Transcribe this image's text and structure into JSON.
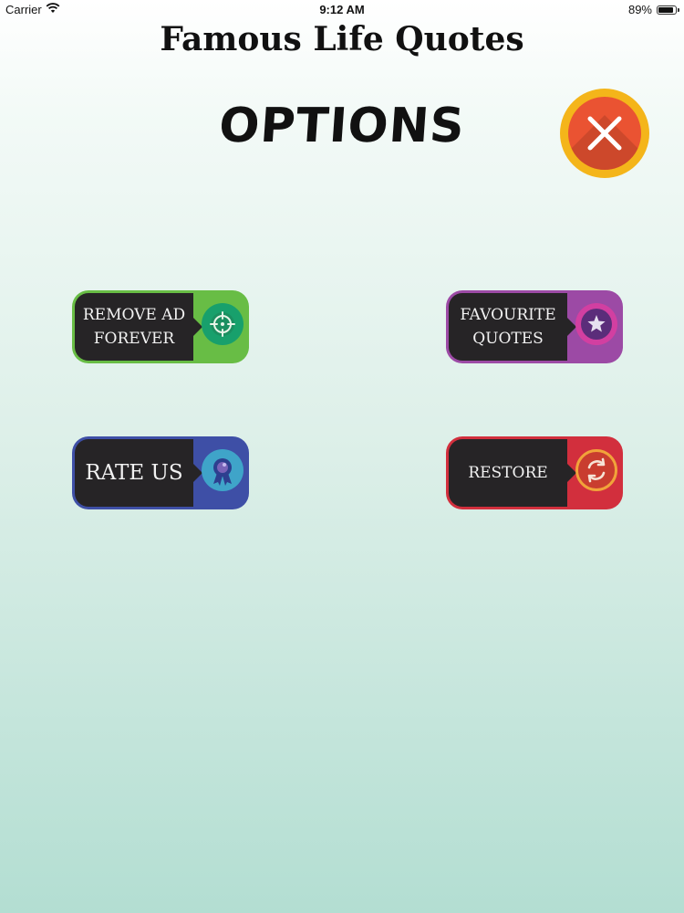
{
  "status_bar": {
    "carrier": "Carrier",
    "time": "9:12 AM",
    "battery_percent": "89%",
    "battery_level": 0.89,
    "wifi_icon": "wifi-icon",
    "battery_icon": "battery-icon"
  },
  "app": {
    "title": "Famous Life Quotes"
  },
  "options": {
    "title": "OPTIONS",
    "close_icon": "close-icon"
  },
  "buttons": {
    "remove_ad": {
      "line1": "REMOVE AD",
      "line2": "FOREVER",
      "icon": "target-icon",
      "color": "#68bd45"
    },
    "favourite": {
      "line1": "FAVOURITE",
      "line2": "QUOTES",
      "icon": "star-icon",
      "color": "#9c4aa5"
    },
    "rate": {
      "label": "RATE US",
      "icon": "award-ribbon-icon",
      "color": "#3e4fa6"
    },
    "restore": {
      "label": "RESTORE",
      "icon": "refresh-icon",
      "color": "#d22f3d"
    }
  },
  "colors": {
    "close_outer": "#f4b51a",
    "close_inner": "#ea5332",
    "button_dark": "#262426"
  }
}
